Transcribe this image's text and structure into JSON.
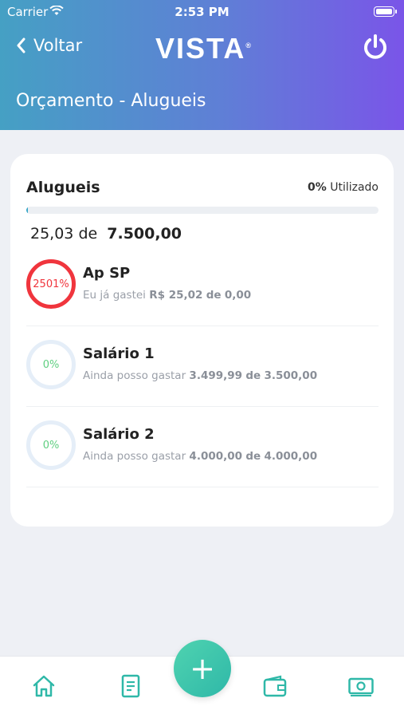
{
  "status": {
    "carrier": "Carrier",
    "time": "2:53 PM"
  },
  "header": {
    "back_label": "Voltar",
    "logo_text": "VISTA",
    "logo_mark": "®",
    "title": "Orçamento - Alugueis",
    "power_icon": "power-icon"
  },
  "card": {
    "title": "Alugueis",
    "usage_percent": "0%",
    "usage_label": "Utilizado",
    "progress_fraction": 0.0033,
    "spent": "25,03",
    "of_label": "de",
    "total": "7.500,00"
  },
  "items": [
    {
      "name": "Ap SP",
      "percent": "2501%",
      "status": "over",
      "prefix": "Eu já gastei",
      "amount": "R$ 25,02",
      "of_label": "de",
      "limit": "0,00"
    },
    {
      "name": "Salário 1",
      "percent": "0%",
      "status": "ok",
      "prefix": "Ainda posso gastar",
      "amount": "3.499,99",
      "of_label": "de",
      "limit": "3.500,00"
    },
    {
      "name": "Salário 2",
      "percent": "0%",
      "status": "ok",
      "prefix": "Ainda posso gastar",
      "amount": "4.000,00",
      "of_label": "de",
      "limit": "4.000,00"
    }
  ],
  "tabs": [
    "home-icon",
    "document-icon",
    "wallet-icon",
    "money-icon"
  ],
  "fab_label": "+",
  "colors": {
    "accent": "#2fb8a8",
    "over": "#f0353d",
    "ok": "#5fcf80",
    "header_start": "#45a0c4",
    "header_end": "#7a55e8"
  }
}
